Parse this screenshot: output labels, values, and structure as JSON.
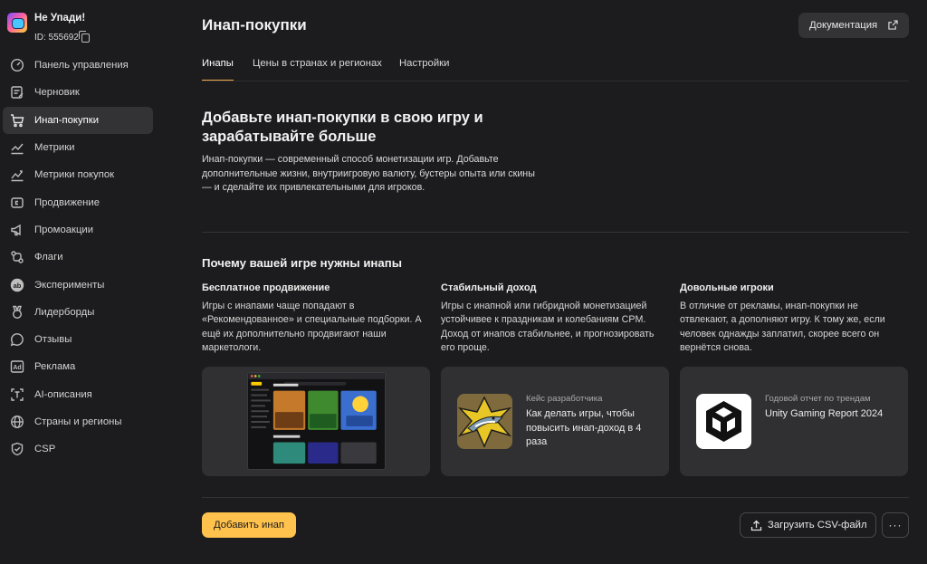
{
  "app": {
    "name": "Не Упади!",
    "id": "ID: 555692"
  },
  "sidebar": {
    "items": [
      {
        "label": "Панель управления",
        "icon": "dashboard-icon"
      },
      {
        "label": "Черновик",
        "icon": "draft-icon"
      },
      {
        "label": "Инап-покупки",
        "icon": "cart-icon",
        "active": true
      },
      {
        "label": "Метрики",
        "icon": "metrics-icon"
      },
      {
        "label": "Метрики покупок",
        "icon": "purchase-metrics-icon"
      },
      {
        "label": "Продвижение",
        "icon": "promotion-icon"
      },
      {
        "label": "Промоакции",
        "icon": "megaphone-icon"
      },
      {
        "label": "Флаги",
        "icon": "flags-icon"
      },
      {
        "label": "Эксперименты",
        "icon": "ab-icon"
      },
      {
        "label": "Лидерборды",
        "icon": "medal-icon"
      },
      {
        "label": "Отзывы",
        "icon": "reviews-icon"
      },
      {
        "label": "Реклама",
        "icon": "ad-icon"
      },
      {
        "label": "AI-описания",
        "icon": "ai-text-icon"
      },
      {
        "label": "Страны и регионы",
        "icon": "globe-icon"
      },
      {
        "label": "CSP",
        "icon": "shield-icon"
      }
    ]
  },
  "header": {
    "title": "Инап-покупки",
    "docs_label": "Документация"
  },
  "tabs": [
    {
      "label": "Инапы",
      "active": true
    },
    {
      "label": "Цены в странах и регионах"
    },
    {
      "label": "Настройки"
    }
  ],
  "hero": {
    "title": "Добавьте инап-покупки в свою игру и зарабатывайте больше",
    "text": "Инап-покупки — современный способ монетизации игр. Добавьте дополнительные жизни, внутриигровую валюту, бустеры опыта или скины — и сделайте их привлекательными для игроков."
  },
  "why": {
    "title": "Почему вашей игре нужны инапы",
    "columns": [
      {
        "title": "Бесплатное продвижение",
        "text": "Игры с инапами чаще попадают в «Рекомендованное» и специальные подборки. А ещё их дополнительно продвигают наши маркетологи."
      },
      {
        "title": "Стабильный доход",
        "text": "Игры с инапной или гибридной монетизацией устойчивее к праздникам и колебаниям CPM. Доход от инапов стабильнее, и прогнозировать его проще."
      },
      {
        "title": "Довольные игроки",
        "text": "В отличие от рекламы, инап-покупки не отвлекают, а дополняют игру. К тому же, если человек однажды заплатил, скорее всего он вернётся снова."
      }
    ]
  },
  "cards": [
    {
      "kind": "screenshot"
    },
    {
      "caption": "Кейс разработчика",
      "title": "Как делать игры, чтобы повысить инап-доход в 4 раза"
    },
    {
      "caption": "Годовой отчет по трендам",
      "title": "Unity Gaming Report 2024"
    }
  ],
  "footer": {
    "add_label": "Добавить инап",
    "csv_label": "Загрузить CSV-файл",
    "more_label": "···"
  },
  "colors": {
    "accent": "#ffc24d",
    "tab_underline": "#f0a84a",
    "bg": "#1c1c1e",
    "card": "#303033"
  }
}
